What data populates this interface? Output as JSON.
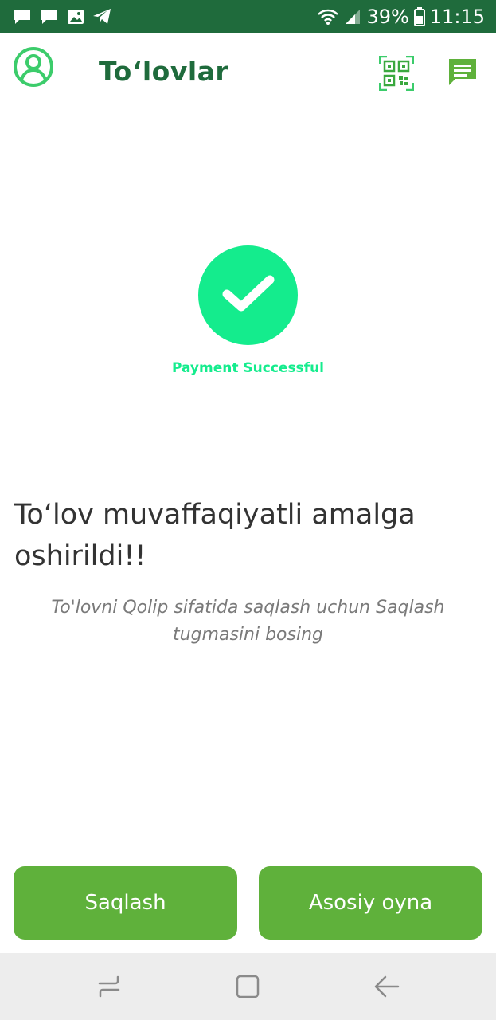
{
  "status_bar": {
    "battery": "39%",
    "time": "11:15",
    "icons": [
      "chat-notification-icon",
      "message-notification-icon",
      "image-notification-icon",
      "telegram-icon",
      "wifi-icon",
      "signal-icon",
      "battery-icon"
    ]
  },
  "header": {
    "title": "To‘lovlar",
    "icons": [
      "profile-icon",
      "qr-code-icon",
      "chat-icon"
    ]
  },
  "success": {
    "icon": "checkmark-icon",
    "label": "Payment Successful"
  },
  "message": {
    "main": "To‘lov muvaffaqiyatli amalga oshirildi!!",
    "hint": "To'lovni Qolip sifatida saqlash uchun Saqlash tugmasini bosing"
  },
  "buttons": {
    "save": "Saqlash",
    "home": "Asosiy oyna"
  },
  "nav_bar": {
    "icons": [
      "recent-apps-icon",
      "home-icon",
      "back-icon"
    ]
  },
  "colors": {
    "header_green": "#1f6b3c",
    "success_green": "#14ec8d",
    "button_green": "#5fb13b",
    "profile_green": "#3ccc6b"
  }
}
